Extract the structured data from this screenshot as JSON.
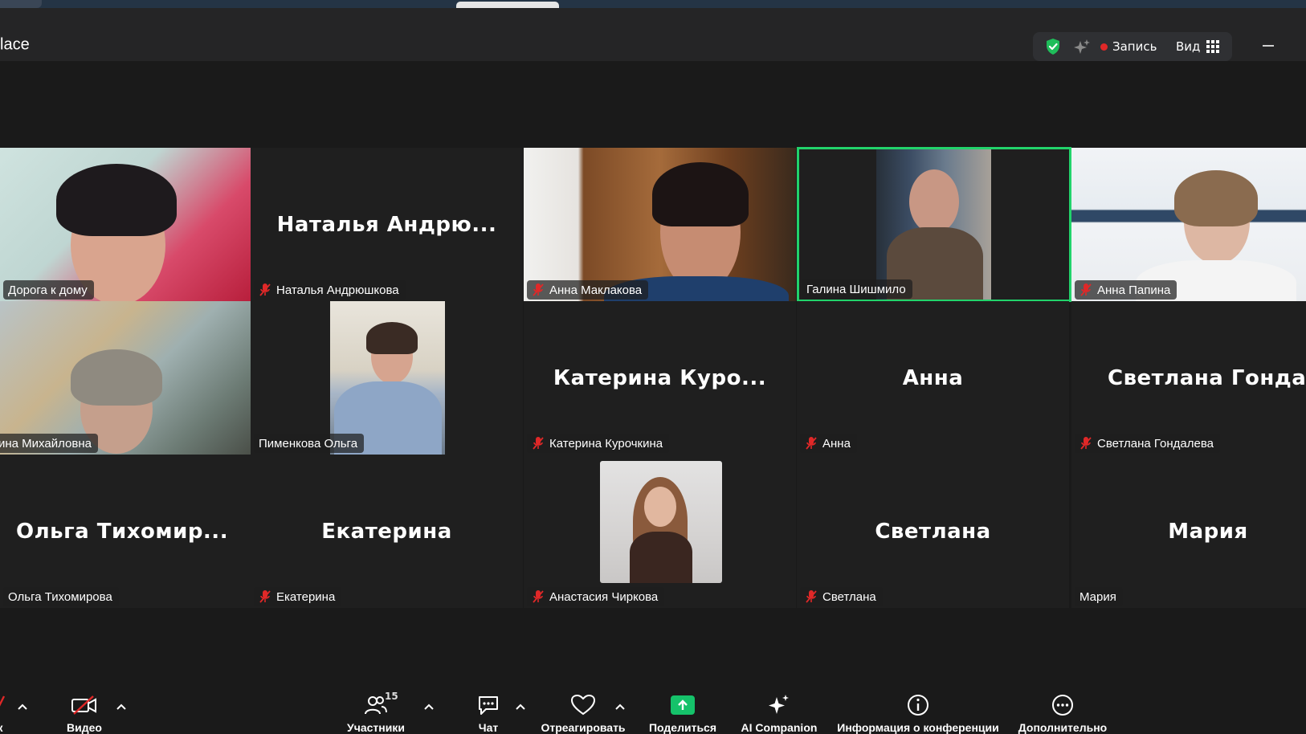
{
  "window": {
    "title_partial": "lace"
  },
  "top_bar": {
    "record_label": "Запись",
    "view_label": "Вид",
    "colors": {
      "shield": "#1fbd5a",
      "record_dot": "#e02828"
    }
  },
  "speaking_color": "#22d36b",
  "participants": [
    {
      "label": "Дорога к дому",
      "muted": false,
      "has_video": true,
      "center_name": ""
    },
    {
      "label": "Наталья Андрюшкова",
      "muted": true,
      "has_video": false,
      "center_name": "Наталья  Андрю..."
    },
    {
      "label": "Анна Маклакова",
      "muted": true,
      "has_video": true,
      "center_name": ""
    },
    {
      "label": "Галина Шишмило",
      "muted": false,
      "has_video": true,
      "center_name": "",
      "speaking": true
    },
    {
      "label": "Анна Папина",
      "muted": true,
      "has_video": true,
      "center_name": ""
    },
    {
      "label": "ина Михайловна",
      "muted": false,
      "has_video": true,
      "center_name": ""
    },
    {
      "label": "Пименкова Ольга",
      "muted": false,
      "has_video": true,
      "center_name": ""
    },
    {
      "label": "Катерина Курочкина",
      "muted": true,
      "has_video": false,
      "center_name": "Катерина  Куро..."
    },
    {
      "label": "Анна",
      "muted": true,
      "has_video": false,
      "center_name": "Анна"
    },
    {
      "label": "Светлана Гондалева",
      "muted": true,
      "has_video": false,
      "center_name": "Светлана  Гонда..."
    },
    {
      "label": "Ольга Тихомирова",
      "muted": false,
      "has_video": false,
      "center_name": "Ольга  Тихомир..."
    },
    {
      "label": "Екатерина",
      "muted": true,
      "has_video": false,
      "center_name": "Екатерина"
    },
    {
      "label": "Анастасия Чиркова",
      "muted": true,
      "has_video": true,
      "center_name": ""
    },
    {
      "label": "Светлана",
      "muted": true,
      "has_video": false,
      "center_name": "Светлана"
    },
    {
      "label": "Мария",
      "muted": false,
      "has_video": false,
      "center_name": "Мария"
    }
  ],
  "toolbar": {
    "audio_label_partial": "к",
    "video_label": "Видео",
    "participants_label": "Участники",
    "participants_count": "15",
    "chat_label": "Чат",
    "react_label": "Отреагировать",
    "share_label": "Поделиться",
    "ai_label": "AI Companion",
    "info_label": "Информация о конференции",
    "more_label": "Дополнительно",
    "icons": [
      "mic-off-icon",
      "video-off-icon",
      "participants-icon",
      "chat-icon",
      "heart-icon",
      "share-screen-icon",
      "sparkle-icon",
      "info-icon",
      "more-icon"
    ],
    "colors": {
      "share": "#15c26a",
      "muted_red": "#e02828"
    }
  }
}
